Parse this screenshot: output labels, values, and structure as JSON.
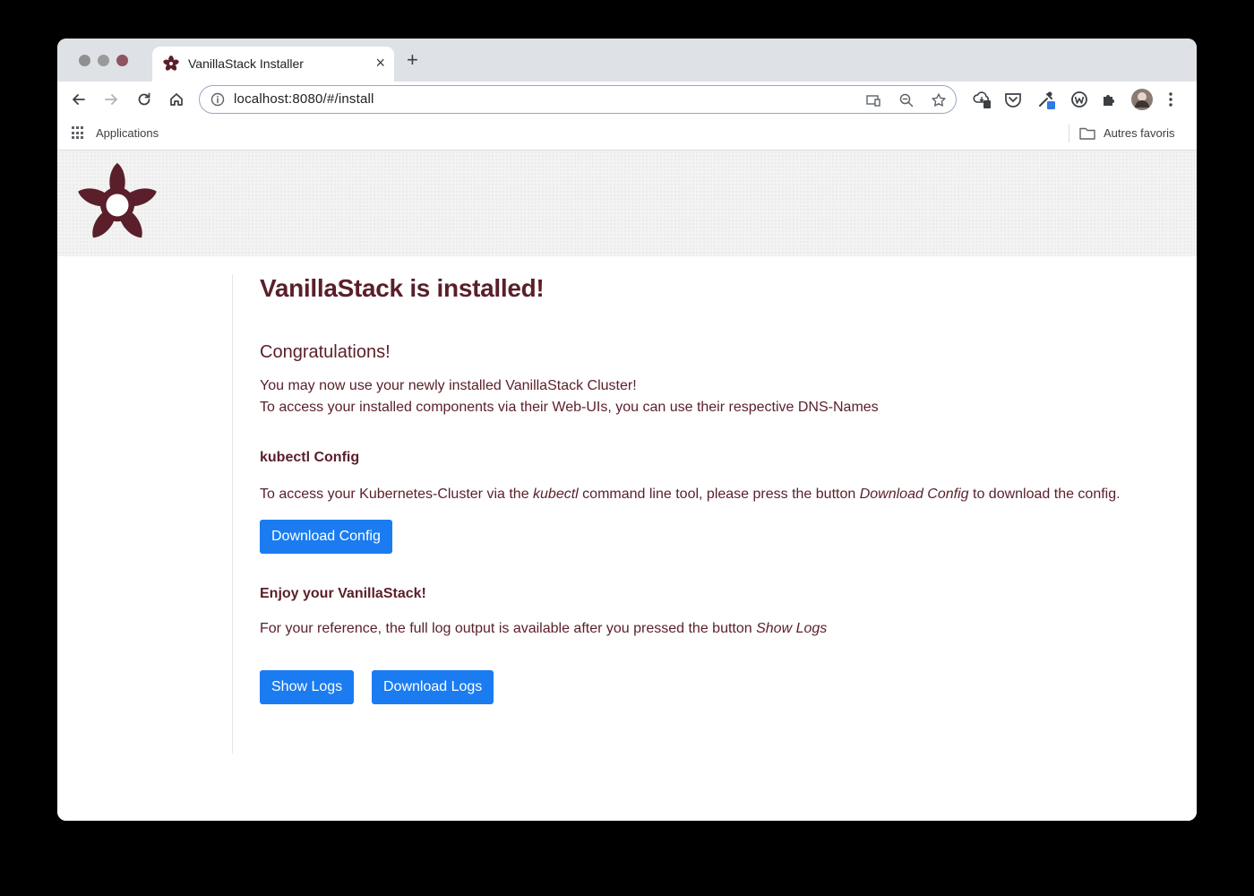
{
  "browser": {
    "tab_title": "VanillaStack Installer",
    "tab_close": "×",
    "new_tab": "+",
    "url": "localhost:8080/#/install",
    "bookmarks": {
      "apps_label": "Applications",
      "other_label": "Autres favoris"
    }
  },
  "page": {
    "title": "VanillaStack is installed!",
    "congrats_heading": "Congratulations!",
    "congrats_line1": "You may now use your newly installed VanillaStack Cluster!",
    "congrats_line2": "To access your installed components via their Web-UIs, you can use their respective DNS-Names",
    "kubectl_heading": "kubectl Config",
    "kubectl_text_before": "To access your Kubernetes-Cluster via the ",
    "kubectl_text_tool": "kubectl",
    "kubectl_text_middle": " command line tool, please press the button ",
    "kubectl_text_button": "Download Config",
    "kubectl_text_after": " to download the config.",
    "download_config_button": "Download Config",
    "enjoy_heading": "Enjoy your VanillaStack!",
    "logs_text_before": "For your reference, the full log output is available after you pressed the button ",
    "logs_text_button": "Show Logs",
    "show_logs_button": "Show Logs",
    "download_logs_button": "Download Logs"
  },
  "colors": {
    "brand": "#5a1f2a",
    "button": "#1a7cf0"
  }
}
